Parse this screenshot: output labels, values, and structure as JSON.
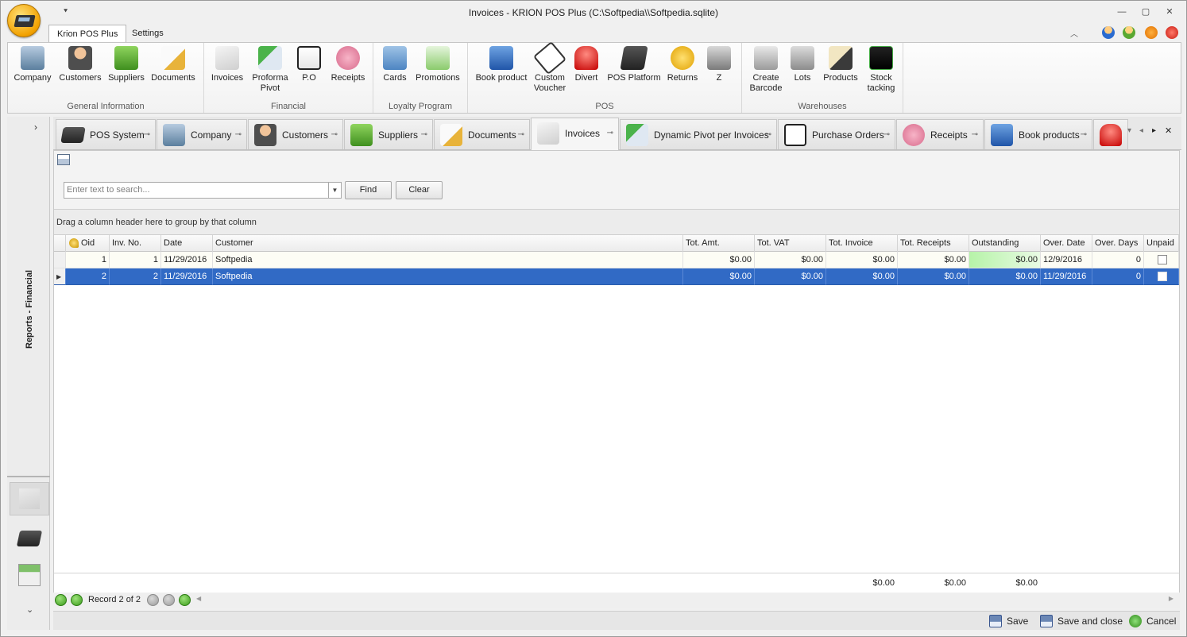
{
  "window": {
    "title": "Invoices - KRION POS Plus (C:\\Softpedia\\\\Softpedia.sqlite)",
    "qat_glyph": "⯆"
  },
  "ribbon_tabs": [
    "Krion POS Plus",
    "Settings"
  ],
  "ribbon": {
    "groups": [
      {
        "label": "General Information",
        "items": [
          "Company",
          "Customers",
          "Suppliers",
          "Documents"
        ]
      },
      {
        "label": "Financial",
        "items": [
          "Invoices",
          "Proforma\nPivot",
          "P.O",
          "Receipts"
        ]
      },
      {
        "label": "Loyalty Program",
        "items": [
          "Cards",
          "Promotions"
        ]
      },
      {
        "label": "POS",
        "items": [
          "Book product",
          "Custom\nVoucher",
          "Divert",
          "POS Platform",
          "Returns",
          "Z"
        ]
      },
      {
        "label": "Warehouses",
        "items": [
          "Create\nBarcode",
          "Lots",
          "Products",
          "Stock\ntacking"
        ]
      }
    ]
  },
  "leftnav": {
    "label": "Reports - Financial",
    "chevron": "›",
    "down": "⌄"
  },
  "doc_tabs": [
    "POS System",
    "Company",
    "Customers",
    "Suppliers",
    "Documents",
    "Invoices",
    "Dynamic Pivot per Invoices",
    "Purchase Orders",
    "Receipts",
    "Book products",
    ""
  ],
  "search": {
    "placeholder": "Enter text to search...",
    "find": "Find",
    "clear": "Clear"
  },
  "group_hint": "Drag a column header here to group by that column",
  "grid": {
    "columns": [
      "Oid",
      "Inv. No.",
      "Date",
      "Customer",
      "Tot. Amt.",
      "Tot. VAT",
      "Tot. Invoice",
      "Tot. Receipts",
      "Outstanding",
      "Over. Date",
      "Over. Days",
      "Unpaid"
    ],
    "rows": [
      {
        "oid": "1",
        "inv": "1",
        "date": "11/29/2016",
        "customer": "Softpedia",
        "amt": "$0.00",
        "vat": "$0.00",
        "invoice": "$0.00",
        "receipts": "$0.00",
        "outstanding": "$0.00",
        "over_date": "12/9/2016",
        "over_days": "0"
      },
      {
        "oid": "2",
        "inv": "2",
        "date": "11/29/2016",
        "customer": "Softpedia",
        "amt": "$0.00",
        "vat": "$0.00",
        "invoice": "$0.00",
        "receipts": "$0.00",
        "outstanding": "$0.00",
        "over_date": "11/29/2016",
        "over_days": "0"
      }
    ],
    "totals": {
      "invoice": "$0.00",
      "receipts": "$0.00",
      "outstanding": "$0.00"
    }
  },
  "navigator": {
    "record": "Record 2 of 2"
  },
  "status": {
    "save": "Save",
    "save_close": "Save and close",
    "cancel": "Cancel"
  },
  "colors": {
    "selection": "#316ac5",
    "outstanding_bar": "#b6f3a8"
  }
}
